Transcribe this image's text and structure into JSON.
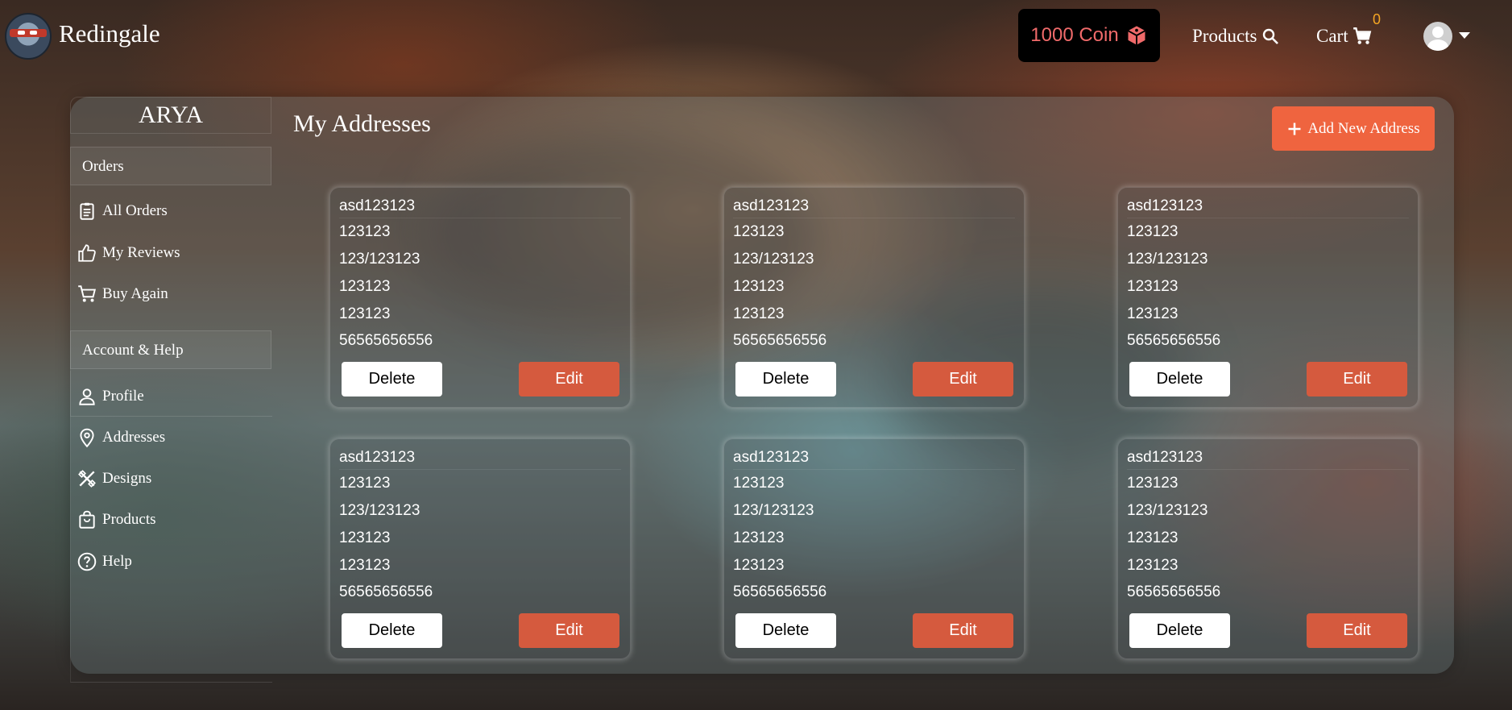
{
  "header": {
    "brand": "Redingale",
    "coin_label": "1000 Coin",
    "nav_products": "Products",
    "nav_cart": "Cart",
    "cart_count": "0"
  },
  "sidebar": {
    "user_name": "ARYA",
    "section_orders": "Orders",
    "orders_items": [
      {
        "label": "All Orders",
        "icon": "clipboard-icon"
      },
      {
        "label": "My Reviews",
        "icon": "thumbs-up-icon"
      },
      {
        "label": "Buy Again",
        "icon": "cart-icon"
      }
    ],
    "section_account": "Account & Help",
    "account_items": [
      {
        "label": "Profile",
        "icon": "person-icon"
      },
      {
        "label": "Addresses",
        "icon": "location-pin-icon"
      },
      {
        "label": "Designs",
        "icon": "design-tools-icon"
      },
      {
        "label": "Products",
        "icon": "shopping-bag-icon"
      },
      {
        "label": "Help",
        "icon": "help-circle-icon"
      }
    ]
  },
  "main": {
    "title": "My Addresses",
    "add_button": "Add New Address",
    "delete_label": "Delete",
    "edit_label": "Edit",
    "addresses": [
      {
        "name": "asd123123",
        "line1": "123123",
        "line2": "123/123123",
        "line3": "123123",
        "line4": "123123",
        "phone": "56565656556"
      },
      {
        "name": "asd123123",
        "line1": "123123",
        "line2": "123/123123",
        "line3": "123123",
        "line4": "123123",
        "phone": "56565656556"
      },
      {
        "name": "asd123123",
        "line1": "123123",
        "line2": "123/123123",
        "line3": "123123",
        "line4": "123123",
        "phone": "56565656556"
      },
      {
        "name": "asd123123",
        "line1": "123123",
        "line2": "123/123123",
        "line3": "123123",
        "line4": "123123",
        "phone": "56565656556"
      },
      {
        "name": "asd123123",
        "line1": "123123",
        "line2": "123/123123",
        "line3": "123123",
        "line4": "123123",
        "phone": "56565656556"
      },
      {
        "name": "asd123123",
        "line1": "123123",
        "line2": "123/123123",
        "line3": "123123",
        "line4": "123123",
        "phone": "56565656556"
      }
    ]
  },
  "colors": {
    "accent": "#ef643f",
    "edit_button": "#d55a3e",
    "coin_text": "#f06a6a",
    "cart_count": "#f5a623"
  }
}
